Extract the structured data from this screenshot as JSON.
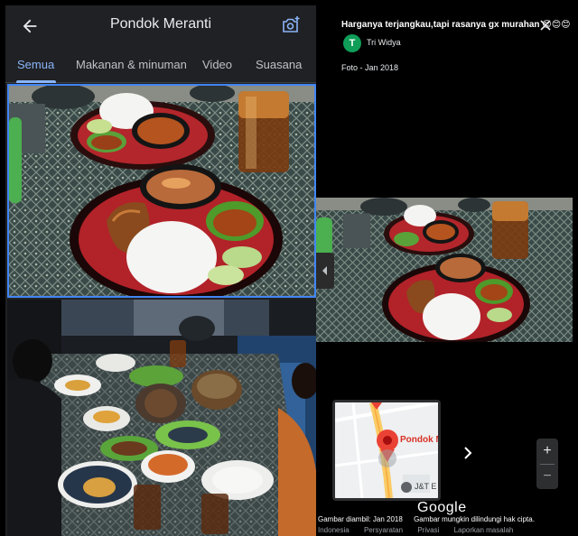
{
  "header": {
    "title": "Pondok Meranti"
  },
  "tabs": [
    {
      "label": "Semua"
    },
    {
      "label": "Makanan & minuman"
    },
    {
      "label": "Video"
    },
    {
      "label": "Suasana"
    }
  ],
  "review": {
    "text": "Harganya terjangkau,tapi rasanya gx murahan 😊😊😊",
    "author_initial": "T",
    "author_name": "Tri Widya",
    "photo_date": "Foto - Jan 2018"
  },
  "map": {
    "place_label": "Pondok M",
    "secondary_label": "J&T E"
  },
  "zoom": {
    "plus": "+",
    "minus": "−"
  },
  "footer": {
    "logo_text": "Google",
    "capture_date": "Gambar diambil: Jan 2018",
    "copyright": "Gambar mungkin dilindungi hak cipta.",
    "links": [
      "Indonesia",
      "Persyaratan",
      "Privasi",
      "Laporkan masalah"
    ]
  },
  "colors": {
    "accent": "#8ab4f8",
    "selection_border": "#4285f4",
    "avatar_bg": "#0f9d58",
    "panel_bg": "#202124"
  }
}
